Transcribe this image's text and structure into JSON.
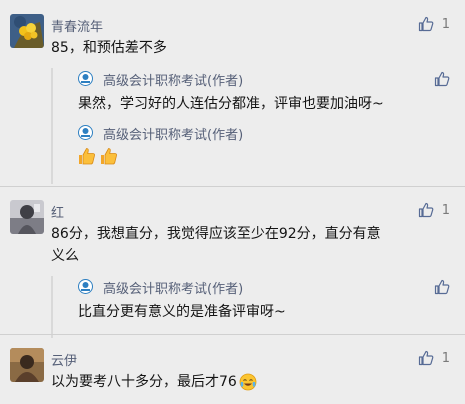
{
  "comments": [
    {
      "name": "青春流年",
      "text": "85，和预估差不多",
      "like_count": "1",
      "replies": [
        {
          "author": "高级会计职称考试(作者)",
          "text": "果然，学习好的人连估分都准，评审也要加油呀~"
        },
        {
          "author": "高级会计职称考试(作者)",
          "text": ""
        }
      ]
    },
    {
      "name": "红",
      "text_line1": "86分，我想直分，我觉得应该至少在92分，直分有意",
      "text_line2": "义么",
      "like_count": "1",
      "reply": {
        "author": "高级会计职称考试(作者)",
        "text": "比直分更有意义的是准备评审呀~"
      }
    },
    {
      "name": "云伊",
      "text": "以为要考八十多分，最后才76",
      "like_count": "1"
    }
  ],
  "icons": {
    "like": "thumb-up-icon",
    "thumb_emoji": "thumbs-up-emoji",
    "cry_emoji": "crying-laughing-emoji"
  },
  "colors": {
    "name": "#566078",
    "like_icon": "#576b95",
    "background": "#ededed",
    "bar": "#d9d9d9"
  }
}
